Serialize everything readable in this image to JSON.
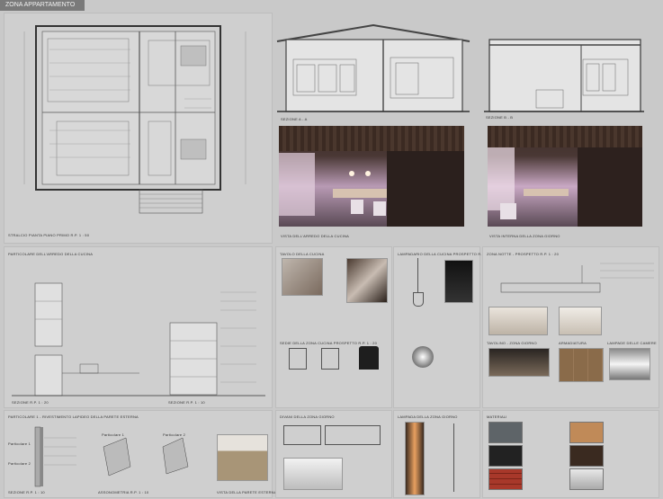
{
  "header": {
    "title": "ZONA APPARTAMENTO"
  },
  "captions": {
    "plan": "STRALCIO PIANTA PIANO PRIMO  R.P. 1 : 50",
    "sec_aa": "SEZIONE A - A",
    "sec_bb": "SEZIONE B - B",
    "render_kitchen": "VISTA DELL'ARREDO DELLA CUCINA",
    "render_living": "VISTA INTERNA DELLA ZONA GIORNO",
    "kitchen_details": "PARTICOLARE DELL'ARREDO DELLA CUCINA",
    "kitchen_sec_1": "SEZIONE  R.P. 1 : 20",
    "kitchen_sec_2": "SEZIONE  R.P. 1 : 10",
    "table": "TAVOLO DELLA CUCINA",
    "chairs": "SEDIE DELLA ZONA CUCINA  PROSPETTO  R.P. 1 : 20",
    "lamp": "LAMPADARIO DELLA CUCINA  PROSPETTO  R.P. 1 : 20",
    "night": "ZONA NOTTE - PROSPETTO  R.P. 1 : 20",
    "bedtable": "TAVOLINO - ZONA GIORNO",
    "wardrobe": "ARMADIATURA",
    "bedlamps": "LAMPADE DELLE CAMERE",
    "cladding": "PARTICOLARE 1 - RIVESTIMENTO LAPIDEO DELLA PARETE ESTERNA",
    "cladding_sec": "SEZIONE  R.P. 1 : 10",
    "axon": "ASSONOMETRIA  R.P. 1 : 10",
    "ext_view": "VISTA DELLA PARETE ESTERNA",
    "sofa": "DIVANI DELLA ZONA GIORNO",
    "floorlamp": "LAMPADA DELLA ZONA GIORNO",
    "materials": "MATERIALI",
    "part1": "Particolare 1",
    "part2": "Particolare 2"
  },
  "palette": {
    "bg": "#c9c9c9",
    "header": "#7a7a7a",
    "render_dark": "#3a2f2c",
    "render_pink": "#c9a8c4",
    "wood": "#8a6b4a"
  }
}
